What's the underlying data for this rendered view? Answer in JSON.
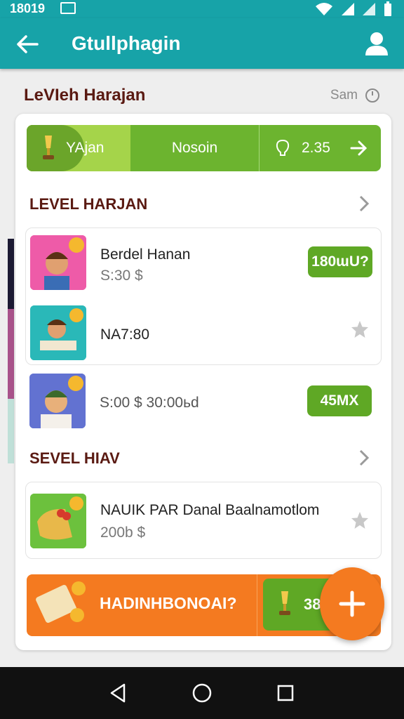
{
  "status_bar": {
    "time": "18019"
  },
  "app_bar": {
    "title": "Gtullphagin"
  },
  "header": {
    "title": "LeVIeh Harajan",
    "sort_label": "Sam"
  },
  "segments": {
    "first": "YAjan",
    "second": "Nosoin",
    "third": "2.35"
  },
  "sections": [
    {
      "title": "LEVEL HARJAN"
    },
    {
      "title": "SEVEL HIAV"
    }
  ],
  "items": [
    {
      "title": "Berdel Hanan",
      "subtitle": "S:30 $",
      "badge": "180ɯU?"
    },
    {
      "title": "NA7:80",
      "subtitle": "",
      "badge": ""
    },
    {
      "title": "S:00 $ 30:00ьd",
      "subtitle": "",
      "badge": "45MX"
    },
    {
      "title": "NAUIK PAR Danal Baalnamotlom",
      "subtitle": "200b $",
      "badge": ""
    }
  ],
  "promo": {
    "label": "HADINHBONOAI?",
    "value": "38"
  },
  "colors": {
    "teal": "#17a3a8",
    "green": "#6cb42f",
    "orange": "#f47a20",
    "maroon": "#5a1a12"
  },
  "icons": [
    "back-arrow-icon",
    "account-icon",
    "clock-icon",
    "trophy-icon",
    "lightbulb-icon",
    "arrow-right-icon",
    "chevron-right-icon",
    "star-icon",
    "plus-icon",
    "coin-icon"
  ]
}
